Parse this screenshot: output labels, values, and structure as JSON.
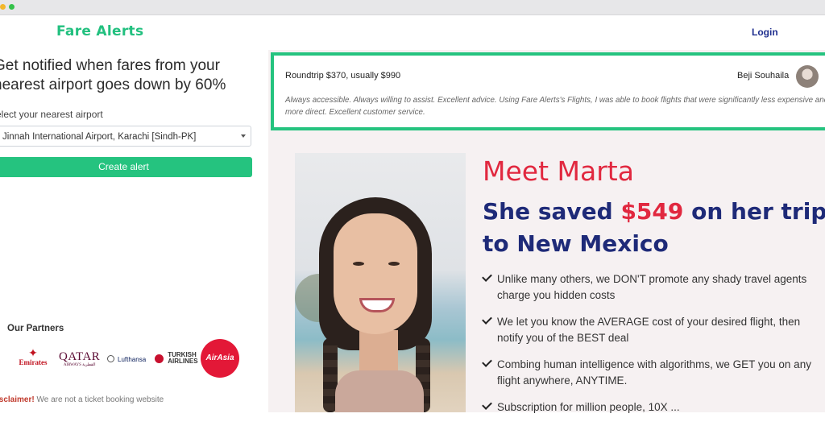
{
  "nav": {
    "logo": "Fare Alerts",
    "login": "Login"
  },
  "form": {
    "headline": "Get notified when fares from your nearest airport goes down by 60%",
    "select_label": "elect your nearest airport",
    "selected_airport": "Jinnah International Airport, Karachi [Sindh-PK]",
    "create_button": "Create alert"
  },
  "partners": {
    "title": "Our Partners",
    "logos": {
      "emirates": "Emirates",
      "qatar": "QATAR",
      "qatar_sub": "AIRWAYS القطرية",
      "lufthansa": "Lufthansa",
      "turkish_1": "TURKISH",
      "turkish_2": "AIRLINES",
      "airasia": "AirAsia"
    }
  },
  "disclaimer": {
    "label": "isclaimer!",
    "text": " We are not a ticket booking website"
  },
  "testimonial": {
    "price": "Roundtrip $370, usually $990",
    "name": "Beji Souhaila",
    "text": "Always accessible. Always willing to assist. Excellent advice. Using Fare Alerts's Flights, I was able to book flights that were significantly less expensive and more direct. Excellent customer service."
  },
  "story": {
    "meet": "Meet Marta",
    "saved_prefix": "She saved ",
    "saved_amount": "$549",
    "saved_suffix": " on her trip to New Mexico",
    "bullets": [
      "Unlike many others, we DON'T promote any shady travel agents charge you hidden costs",
      "We let you know the AVERAGE cost of your desired flight, then notify you of the BEST deal",
      "Combing human intelligence with algorithms, we GET you on any flight anywhere, ANYTIME.",
      "Subscription for million people, 10X ..."
    ]
  },
  "colors": {
    "brand_green": "#25c37f",
    "accent_red": "#e1283f",
    "navy": "#1e2a78"
  }
}
